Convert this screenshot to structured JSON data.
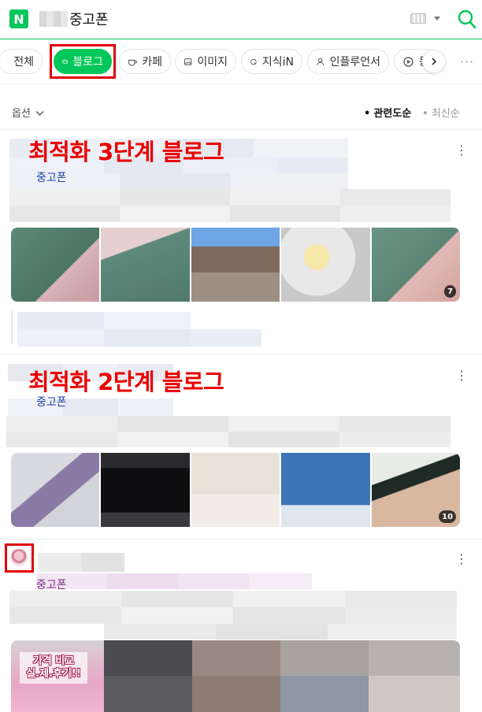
{
  "header": {
    "logo_letter": "N",
    "query": "중고폰",
    "accent": "#03c75a"
  },
  "tabs": [
    {
      "label": "전체",
      "icon": "chevron-left-icon"
    },
    {
      "label": "블로그",
      "icon": "blog-icon",
      "active": true
    },
    {
      "label": "카페",
      "icon": "cafe-cup-icon"
    },
    {
      "label": "이미지",
      "icon": "image-icon"
    },
    {
      "label": "지식iN",
      "icon": "knowledge-q-icon"
    },
    {
      "label": "인플루언서",
      "icon": "person-icon"
    },
    {
      "label": "동",
      "icon": "play-circle-icon"
    }
  ],
  "sort": {
    "options_label": "옵션",
    "relevance_label": "관련도순",
    "latest_label": "최신순"
  },
  "results": [
    {
      "annotation": "최적화 3단계 블로그",
      "source": "중고폰",
      "image_count": "7"
    },
    {
      "annotation": "최적화 2단계 블로그",
      "source": "중고폰",
      "image_count": "10"
    },
    {
      "source": "중고폰",
      "promo_line1": "가격 비교",
      "promo_line2": "실.제.후기!!"
    }
  ],
  "highlight_color": "#e10000"
}
